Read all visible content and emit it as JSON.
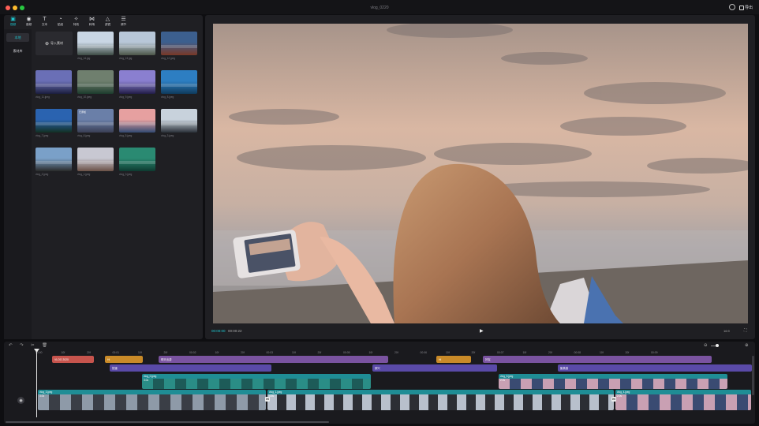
{
  "window": {
    "title": "vlog_0220",
    "export_label": "导出"
  },
  "toolbar": {
    "tools": [
      {
        "icon": "media-icon",
        "glyph": "▣",
        "label": "视频"
      },
      {
        "icon": "audio-icon",
        "glyph": "◉",
        "label": "音频"
      },
      {
        "icon": "text-icon",
        "glyph": "T",
        "label": "文本"
      },
      {
        "icon": "sticker-icon",
        "glyph": "◔",
        "label": "贴纸"
      },
      {
        "icon": "effects-icon",
        "glyph": "✧",
        "label": "特效"
      },
      {
        "icon": "transition-icon",
        "glyph": "⋈",
        "label": "转场"
      },
      {
        "icon": "filter-icon",
        "glyph": "△",
        "label": "滤镜"
      },
      {
        "icon": "adjust-icon",
        "glyph": "☰",
        "label": "调节"
      }
    ]
  },
  "sidenav": {
    "items": [
      {
        "label": "本地"
      },
      {
        "label": "素材库"
      }
    ]
  },
  "media": {
    "import_label": "导入素材",
    "items": [
      {
        "name": "vlog_14.jpg",
        "badge": "",
        "tag": "",
        "c1": "#c9d6e4",
        "c2": "#3d4b44"
      },
      {
        "name": "vlog_13.jpg",
        "badge": "",
        "tag": "",
        "c1": "#b8c7d8",
        "c2": "#4c5648"
      },
      {
        "name": "vlog_12.jpeg",
        "badge": "",
        "tag": "",
        "c1": "#3c5f8e",
        "c2": "#7a3826"
      },
      {
        "name": "vlog_11.jpeg",
        "badge": "",
        "tag": "",
        "c1": "#6a6fb6",
        "c2": "#1b1e3e"
      },
      {
        "name": "vlog_10.jpeg",
        "badge": "",
        "tag": "",
        "c1": "#6f7f6e",
        "c2": "#1d3c2d"
      },
      {
        "name": "vlog_9.jpeg",
        "badge": "",
        "tag": "",
        "c1": "#8a7fd0",
        "c2": "#221d48"
      },
      {
        "name": "vlog_8.jpeg",
        "badge": "",
        "tag": "",
        "c1": "#2d7ec2",
        "c2": "#0f3b5c"
      },
      {
        "name": "vlog_7.jpeg",
        "badge": "",
        "tag": "",
        "c1": "#2a63b0",
        "c2": "#123023"
      },
      {
        "name": "vlog_6.jpeg",
        "badge": "",
        "tag": "已添加",
        "c1": "#6a7fa8",
        "c2": "#3a3f55"
      },
      {
        "name": "vlog_5.jpeg",
        "badge": "",
        "tag": "",
        "c1": "#e6a0a0",
        "c2": "#324a72"
      },
      {
        "name": "vlog_3.jpeg",
        "badge": "",
        "tag": "",
        "c1": "#c8d2dc",
        "c2": "#2a3038"
      },
      {
        "name": "vlog_2.jpeg",
        "badge": "",
        "tag": "",
        "c1": "#7aa0c8",
        "c2": "#2a2a2a"
      },
      {
        "name": "vlog_1.jpeg",
        "badge": "",
        "tag": "",
        "c1": "#c8c8d2",
        "c2": "#6a5046"
      },
      {
        "name": "vlog_0.jpeg",
        "badge": "",
        "tag": "",
        "c1": "#2a8a72",
        "c2": "#0e3a30"
      }
    ]
  },
  "player": {
    "current_time": "00:00:00",
    "total_time": "00:00:22",
    "ratio_label": "16:9"
  },
  "timeline": {
    "ruler": [
      "00:00",
      "10f",
      "20f",
      "00:01",
      "10f",
      "20f",
      "00:02",
      "10f",
      "20f",
      "00:03",
      "10f",
      "20f",
      "00:05",
      "10f",
      "20f",
      "00:06",
      "10f",
      "20f",
      "00:07",
      "10f",
      "20f",
      "00:08",
      "10f",
      "20f",
      "00:09"
    ],
    "text_clips": [
      {
        "label": "VLOG 2020",
        "color": "#c7544d"
      },
      {
        "label": "Hi",
        "color": "#c98a28"
      },
      {
        "label": "晴天出游",
        "color": "#7a53a0"
      },
      {
        "label": "Hi",
        "color": "#c98a28"
      },
      {
        "label": "好友",
        "color": "#7a53a0"
      }
    ],
    "effect_clips": [
      {
        "label": "快速",
        "color": "#5a4aa8"
      },
      {
        "label": "即兴",
        "color": "#5a4aa8"
      },
      {
        "label": "聚焦感",
        "color": "#5a4aa8"
      }
    ],
    "overlay_clips": [
      {
        "label": "vlog_0.jpeg",
        "duration": "3.0s"
      },
      {
        "label": "vlog_5.jpeg",
        "duration": "2.0s"
      }
    ],
    "main_clips": [
      {
        "label": "vlog_3.jpeg",
        "duration": "3.0s"
      },
      {
        "label": "vlog_1.jpeg",
        "duration": "4.5s"
      },
      {
        "label": "vlog_4.jpeg",
        "duration": "2.0s"
      }
    ]
  }
}
